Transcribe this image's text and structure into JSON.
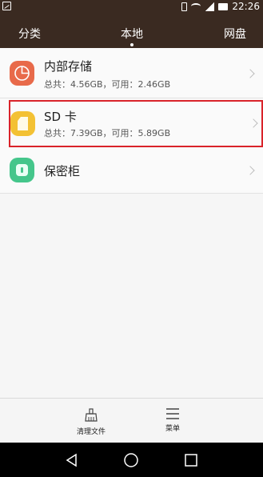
{
  "status_bar": {
    "time": "22:26",
    "icons": [
      "image-icon",
      "vibrate-icon",
      "wifi-icon",
      "signal-icon",
      "battery-icon"
    ]
  },
  "tabs": {
    "items": [
      {
        "label": "分类"
      },
      {
        "label": "本地",
        "active": true
      },
      {
        "label": "网盘"
      }
    ]
  },
  "storage": {
    "items": [
      {
        "title": "内部存储",
        "subtitle": "总共：4.56GB，可用：2.46GB",
        "icon": "pie-chart-icon",
        "icon_color": "#e86a4a"
      },
      {
        "title": "SD 卡",
        "subtitle": "总共：7.39GB，可用：5.89GB",
        "icon": "sd-card-icon",
        "icon_color": "#f3c134",
        "highlighted": true
      },
      {
        "title": "保密柜",
        "icon": "safe-icon",
        "icon_color": "#45c68b"
      }
    ]
  },
  "toolbar": {
    "clean_label": "清理文件",
    "menu_label": "菜单"
  },
  "colors": {
    "header_bg": "#3a2a21",
    "highlight_border": "#d9232a"
  }
}
